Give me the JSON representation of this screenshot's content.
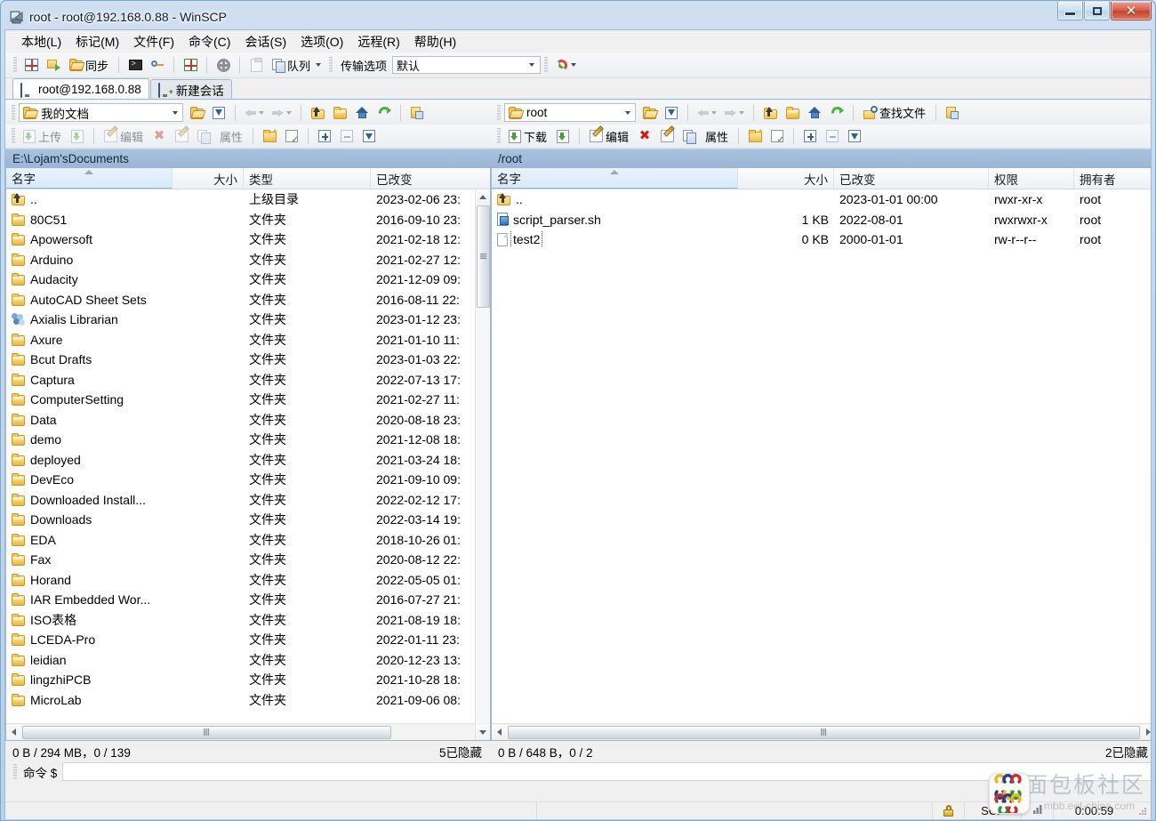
{
  "window": {
    "title": "root - root@192.168.0.88 - WinSCP",
    "app_icon": "winscp-icon",
    "minimize_label": "",
    "maximize_label": "",
    "close_label": "✕"
  },
  "menubar": {
    "items": [
      {
        "label": "本地(L)",
        "name": "menu-local"
      },
      {
        "label": "标记(M)",
        "name": "menu-mark"
      },
      {
        "label": "文件(F)",
        "name": "menu-file"
      },
      {
        "label": "命令(C)",
        "name": "menu-command"
      },
      {
        "label": "会话(S)",
        "name": "menu-session"
      },
      {
        "label": "选项(O)",
        "name": "menu-options"
      },
      {
        "label": "远程(R)",
        "name": "menu-remote"
      },
      {
        "label": "帮助(H)",
        "name": "menu-help"
      }
    ]
  },
  "toolbar": {
    "sync_label": "同步",
    "queue_label": "队列",
    "transfer_settings_label": "传输选项",
    "transfer_preset_value": "默认"
  },
  "tabs": [
    {
      "label": "root@192.168.0.88",
      "icon": "monitor-icon",
      "active": true
    },
    {
      "label": "新建会话",
      "icon": "monitor-plus-icon",
      "active": false
    }
  ],
  "left_pane": {
    "location_value": "我的文档",
    "find_label": "",
    "upload_label": "上传",
    "edit_label": "编辑",
    "properties_label": "属性",
    "path_caption": "E:\\Lojam'sDocuments",
    "columns": [
      {
        "label": "名字",
        "name": "column-name",
        "sorted": true
      },
      {
        "label": "大小",
        "name": "column-size",
        "align": "right"
      },
      {
        "label": "类型",
        "name": "column-type"
      },
      {
        "label": "已改变",
        "name": "column-changed"
      }
    ],
    "rows": [
      {
        "icon": "updir-icon",
        "name": "..",
        "size": "",
        "type": "上级目录",
        "changed": "2023-02-06  23:"
      },
      {
        "icon": "folder-icon",
        "name": "80C51",
        "size": "",
        "type": "文件夹",
        "changed": "2016-09-10  23:"
      },
      {
        "icon": "folder-icon",
        "name": "Apowersoft",
        "size": "",
        "type": "文件夹",
        "changed": "2021-02-18  12:"
      },
      {
        "icon": "folder-icon",
        "name": "Arduino",
        "size": "",
        "type": "文件夹",
        "changed": "2021-02-27  12:"
      },
      {
        "icon": "folder-icon",
        "name": "Audacity",
        "size": "",
        "type": "文件夹",
        "changed": "2021-12-09  09:"
      },
      {
        "icon": "folder-icon",
        "name": "AutoCAD Sheet Sets",
        "size": "",
        "type": "文件夹",
        "changed": "2016-08-11  22:"
      },
      {
        "icon": "axialis-icon",
        "name": "Axialis Librarian",
        "size": "",
        "type": "文件夹",
        "changed": "2023-01-12  23:"
      },
      {
        "icon": "folder-icon",
        "name": "Axure",
        "size": "",
        "type": "文件夹",
        "changed": "2021-01-10  11:"
      },
      {
        "icon": "folder-icon",
        "name": "Bcut Drafts",
        "size": "",
        "type": "文件夹",
        "changed": "2023-01-03  22:"
      },
      {
        "icon": "folder-icon",
        "name": "Captura",
        "size": "",
        "type": "文件夹",
        "changed": "2022-07-13  17:"
      },
      {
        "icon": "folder-icon",
        "name": "ComputerSetting",
        "size": "",
        "type": "文件夹",
        "changed": "2021-02-27  11:"
      },
      {
        "icon": "folder-icon",
        "name": "Data",
        "size": "",
        "type": "文件夹",
        "changed": "2020-08-18  23:"
      },
      {
        "icon": "folder-icon",
        "name": "demo",
        "size": "",
        "type": "文件夹",
        "changed": "2021-12-08  18:"
      },
      {
        "icon": "folder-icon",
        "name": "deployed",
        "size": "",
        "type": "文件夹",
        "changed": "2021-03-24  18:"
      },
      {
        "icon": "folder-icon",
        "name": "DevEco",
        "size": "",
        "type": "文件夹",
        "changed": "2021-09-10  09:"
      },
      {
        "icon": "folder-icon",
        "name": "Downloaded Install...",
        "size": "",
        "type": "文件夹",
        "changed": "2022-02-12  17:"
      },
      {
        "icon": "folder-icon",
        "name": "Downloads",
        "size": "",
        "type": "文件夹",
        "changed": "2022-03-14  19:"
      },
      {
        "icon": "folder-icon",
        "name": "EDA",
        "size": "",
        "type": "文件夹",
        "changed": "2018-10-26  01:"
      },
      {
        "icon": "folder-icon",
        "name": "Fax",
        "size": "",
        "type": "文件夹",
        "changed": "2020-08-12  22:"
      },
      {
        "icon": "folder-icon",
        "name": "Horand",
        "size": "",
        "type": "文件夹",
        "changed": "2022-05-05  01:"
      },
      {
        "icon": "folder-icon",
        "name": "IAR Embedded Wor...",
        "size": "",
        "type": "文件夹",
        "changed": "2016-07-27  21:"
      },
      {
        "icon": "folder-icon",
        "name": "ISO表格",
        "size": "",
        "type": "文件夹",
        "changed": "2021-08-19  18:"
      },
      {
        "icon": "folder-icon",
        "name": "LCEDA-Pro",
        "size": "",
        "type": "文件夹",
        "changed": "2022-01-11  23:"
      },
      {
        "icon": "folder-icon",
        "name": "leidian",
        "size": "",
        "type": "文件夹",
        "changed": "2020-12-23  13:"
      },
      {
        "icon": "folder-icon",
        "name": "lingzhiPCB",
        "size": "",
        "type": "文件夹",
        "changed": "2021-10-28  18:"
      },
      {
        "icon": "folder-icon",
        "name": "MicroLab",
        "size": "",
        "type": "文件夹",
        "changed": "2021-09-06  08:"
      }
    ],
    "status_left": "0 B / 294 MB，0 / 139",
    "status_right": "5已隐藏"
  },
  "right_pane": {
    "location_value": "root",
    "find_label": "查找文件",
    "download_label": "下载",
    "edit_label": "编辑",
    "properties_label": "属性",
    "path_caption": "/root",
    "columns": [
      {
        "label": "名字",
        "name": "column-name",
        "sorted": true
      },
      {
        "label": "大小",
        "name": "column-size",
        "align": "right"
      },
      {
        "label": "已改变",
        "name": "column-changed"
      },
      {
        "label": "权限",
        "name": "column-permissions"
      },
      {
        "label": "拥有者",
        "name": "column-owner"
      }
    ],
    "rows": [
      {
        "icon": "updir-icon",
        "name": "..",
        "size": "",
        "changed": "2023-01-01 00:00",
        "permissions": "rwxr-xr-x",
        "owner": "root",
        "focused": false
      },
      {
        "icon": "script-icon",
        "name": "script_parser.sh",
        "size": "1 KB",
        "changed": "2022-08-01",
        "permissions": "rwxrwxr-x",
        "owner": "root",
        "focused": false
      },
      {
        "icon": "document-icon",
        "name": "test2",
        "size": "0 KB",
        "changed": "2000-01-01",
        "permissions": "rw-r--r--",
        "owner": "root",
        "focused": true
      }
    ],
    "status_left": "0 B / 648 B，0 / 2",
    "status_right": "2已隐藏"
  },
  "command_bar": {
    "label": "命令 $",
    "value": ""
  },
  "status_bar": {
    "lock_icon": "lock-icon",
    "protocol": "SCP",
    "chart_icon": "chart-icon",
    "elapsed": "0:00:59"
  },
  "watermark": {
    "text": "面包板社区",
    "url": "mbb.eet-china.com"
  },
  "colors": {
    "accent": "#9ab6d6",
    "header_bg": "#eef1f4",
    "selection": "#d9e9f8",
    "close_red": "#c24430"
  }
}
